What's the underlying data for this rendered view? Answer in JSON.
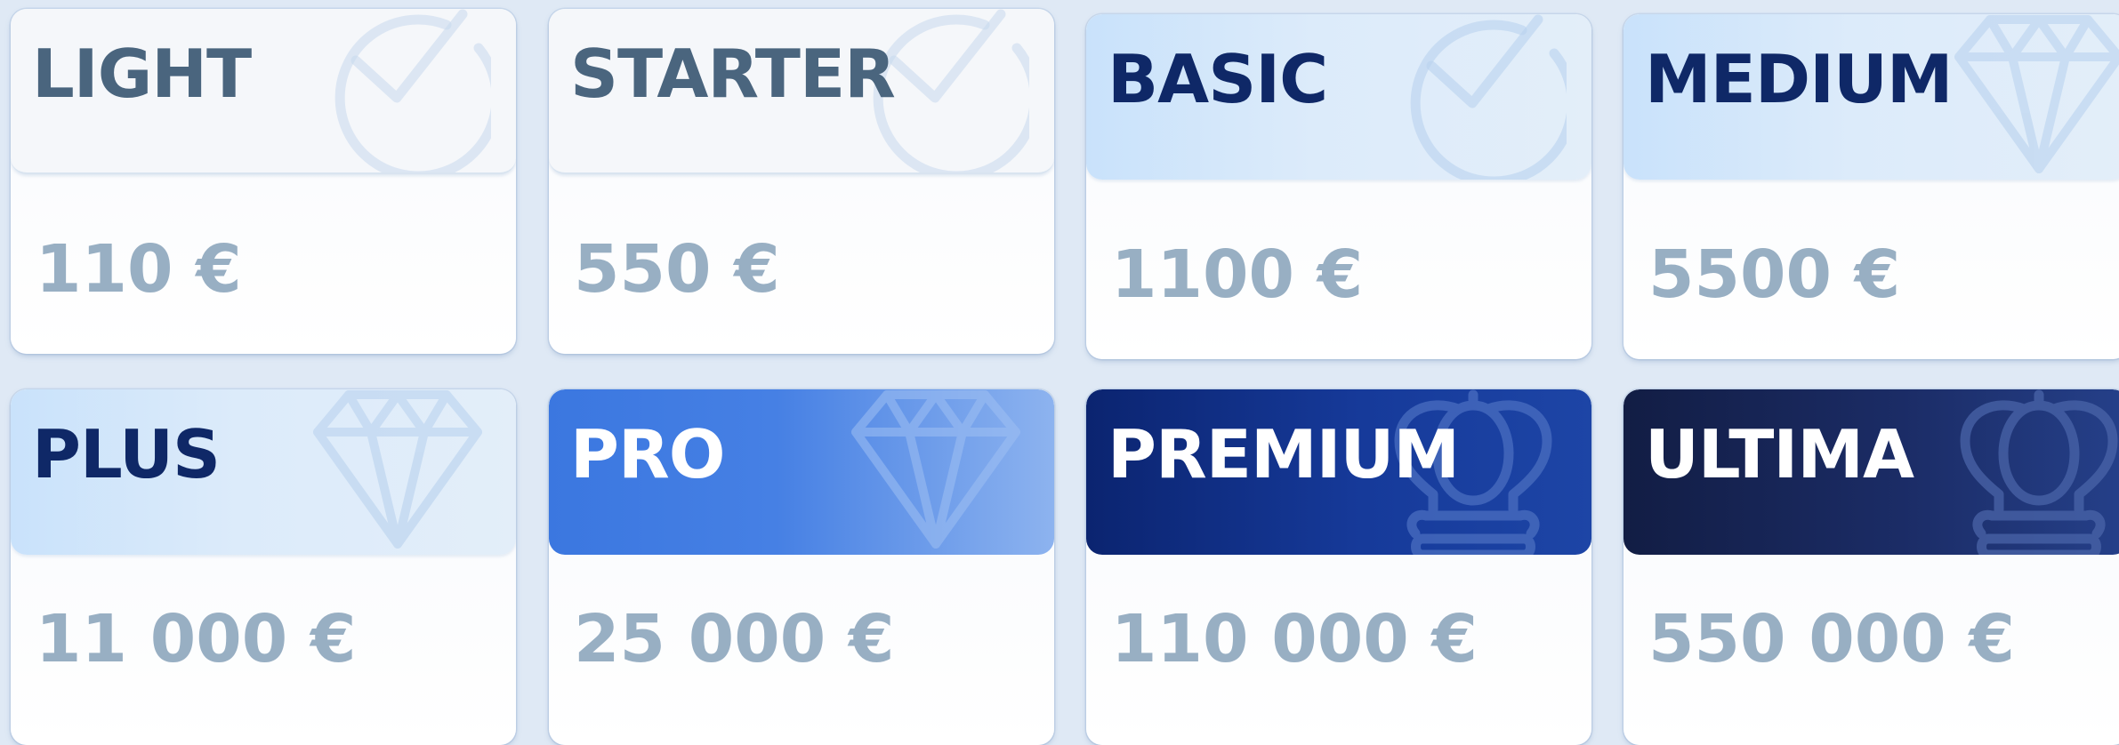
{
  "plans": [
    {
      "name": "LIGHT",
      "price": "110 €",
      "icon": "check-circle-icon",
      "theme": "plain"
    },
    {
      "name": "STARTER",
      "price": "550 €",
      "icon": "check-circle-icon",
      "theme": "plain"
    },
    {
      "name": "BASIC",
      "price": "1100 €",
      "icon": "check-circle-icon",
      "theme": "light"
    },
    {
      "name": "MEDIUM",
      "price": "5500 €",
      "icon": "diamond-icon",
      "theme": "light"
    },
    {
      "name": "PLUS",
      "price": "11 000 €",
      "icon": "diamond-icon",
      "theme": "light"
    },
    {
      "name": "PRO",
      "price": "25 000 €",
      "icon": "diamond-icon",
      "theme": "blue"
    },
    {
      "name": "PREMIUM",
      "price": "110 000 €",
      "icon": "crown-icon",
      "theme": "navy"
    },
    {
      "name": "ULTIMA",
      "price": "550 000 €",
      "icon": "crown-icon",
      "theme": "dark"
    }
  ],
  "colors": {
    "page_background": "#dfe9f5",
    "plain_title": "#4a657e",
    "light_title": "#0f2867",
    "price_text": "#98afc3",
    "pro_header": "#3b77e0",
    "premium_header": "#0b2470",
    "ultima_header": "#121d44"
  }
}
